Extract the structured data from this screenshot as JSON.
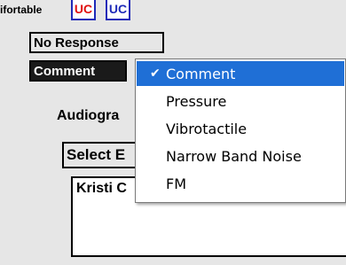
{
  "top": {
    "legend_text": "ifortable",
    "badges": [
      {
        "label": "UC",
        "color": "#e01010"
      },
      {
        "label": "UC",
        "color": "#1f2bb8"
      }
    ]
  },
  "buttons": {
    "no_response": "No Response",
    "comment": "Comment",
    "select": "Select E"
  },
  "labels": {
    "audiogram": "Audiogra"
  },
  "textarea": {
    "value": "Kristi C"
  },
  "dropdown_menu": {
    "selected_index": 0,
    "items": [
      "Comment",
      "Pressure",
      "Vibrotactile",
      "Narrow Band Noise",
      "FM"
    ]
  },
  "colors": {
    "selection": "#1f6fd6",
    "badge_border": "#1f2bb8"
  }
}
